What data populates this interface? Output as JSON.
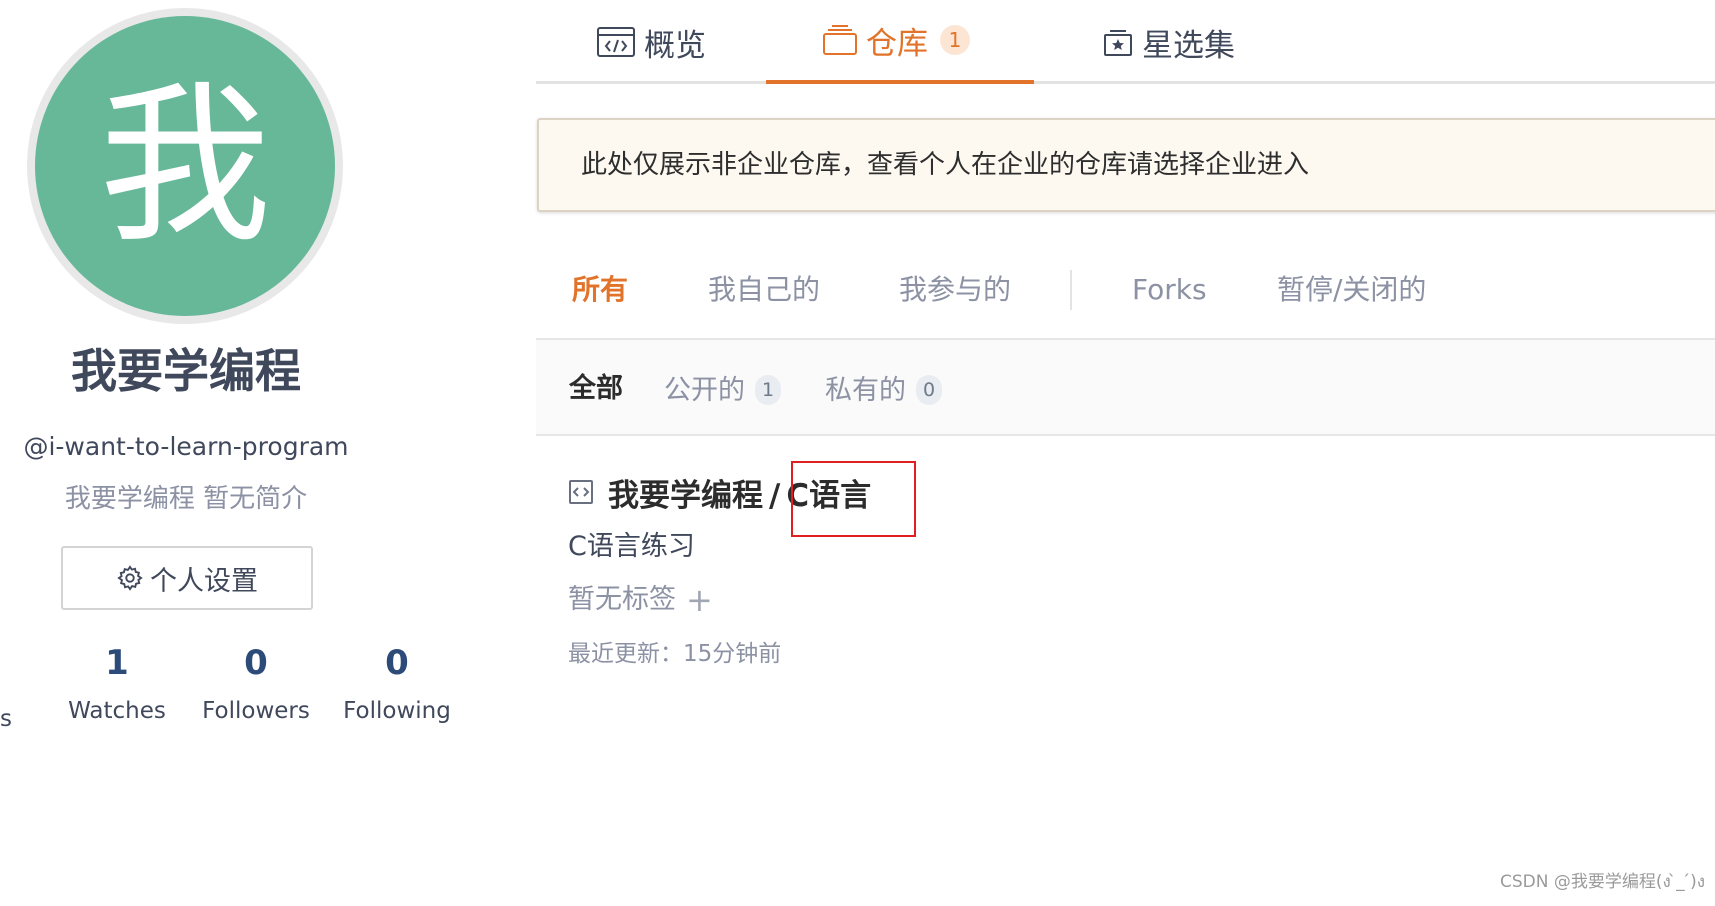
{
  "profile": {
    "avatar_char": "我",
    "avatar_color": "#66b899",
    "display_name": "我要学编程",
    "username": "@i-want-to-learn-program",
    "bio": "我要学编程 暂无简介",
    "settings_label": "个人设置",
    "edge_stat_label": "s",
    "stats": [
      {
        "value": "1",
        "label": "Watches"
      },
      {
        "value": "0",
        "label": "Followers"
      },
      {
        "value": "0",
        "label": "Following"
      }
    ]
  },
  "tabs": [
    {
      "label": "概览",
      "icon": "code-window-icon",
      "active": false
    },
    {
      "label": "仓库",
      "icon": "repo-stack-icon",
      "active": true,
      "badge": "1"
    },
    {
      "label": "星选集",
      "icon": "star-collection-icon",
      "active": false
    }
  ],
  "notice": "此处仅展示非企业仓库，查看个人在企业的仓库请选择企业进入",
  "filters": [
    "所有",
    "我自己的",
    "我参与的",
    "Forks",
    "暂停/关闭的"
  ],
  "visibility": [
    {
      "label": "全部"
    },
    {
      "label": "公开的",
      "count": "1"
    },
    {
      "label": "私有的",
      "count": "0"
    }
  ],
  "repo": {
    "owner": "我要学编程",
    "separator": "/",
    "name": "C语言",
    "description": "C语言练习",
    "tags": "暂无标签",
    "add_tag": "+",
    "updated": "最近更新：15分钟前"
  },
  "colors": {
    "accent": "#e1742a",
    "stat_number": "#2c4b79",
    "highlight_box": "#e02020"
  },
  "watermark": "CSDN @我要学编程(ง ̀_ ́)ง"
}
